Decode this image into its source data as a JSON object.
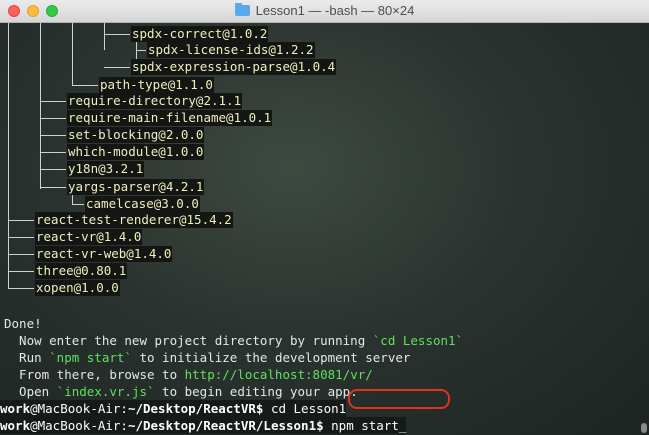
{
  "window": {
    "title": "Lesson1 — -bash — 80×24"
  },
  "tree": {
    "packages": [
      "spdx-correct@1.0.2",
      "spdx-license-ids@1.2.2",
      "spdx-expression-parse@1.0.4",
      "path-type@1.1.0",
      "require-directory@2.1.1",
      "require-main-filename@1.0.1",
      "set-blocking@2.0.0",
      "which-module@1.0.0",
      "y18n@3.2.1",
      "yargs-parser@4.2.1",
      "camelcase@3.0.0",
      "react-test-renderer@15.4.2",
      "react-vr@1.4.0",
      "react-vr-web@1.4.0",
      "three@0.80.1",
      "xopen@1.0.0"
    ]
  },
  "output": {
    "done": "Done!",
    "line1_pre": "  Now enter the new project directory by running ",
    "line1_code": "`cd Lesson1`",
    "line2_pre": "  Run ",
    "line2_code": "`npm start`",
    "line2_post": " to initialize the development server",
    "line3_pre": "  From there, browse to ",
    "line3_url": "http://localhost:8081/vr/",
    "line4_pre": "  Open ",
    "line4_code": "`index.vr.js`",
    "line4_post": " to begin editing your app."
  },
  "prompts": [
    {
      "user": "work",
      "host": "@MacBook-Air:",
      "path": "~/Desktop/ReactVR$",
      "command": " cd Lesson1"
    },
    {
      "user": "work",
      "host": "@MacBook-Air:",
      "path": "~/Desktop/ReactVR/Lesson1$",
      "command": " npm start_"
    }
  ],
  "colors": {
    "traffic_close": "#fc605c",
    "traffic_minimize": "#fdbc40",
    "traffic_zoom": "#34c84a",
    "highlight": "#e0331d",
    "code_green": "#5fe05f",
    "path_cyan": "#5fd7ff"
  }
}
